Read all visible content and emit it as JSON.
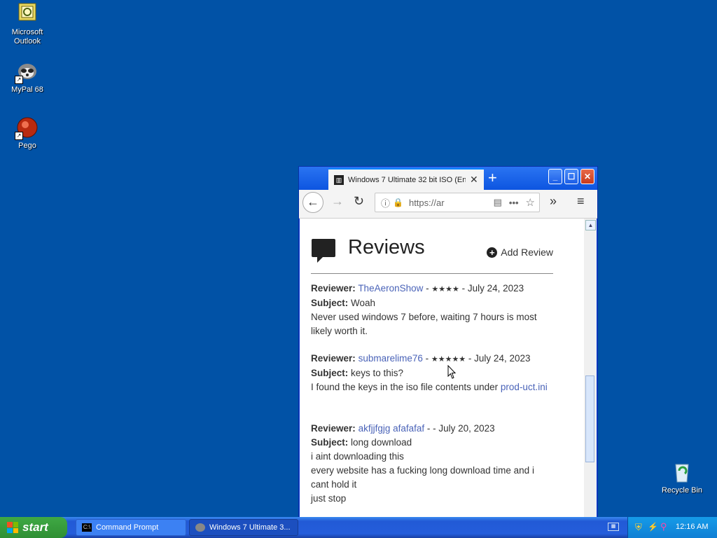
{
  "desktop": {
    "icons": [
      {
        "label": "Microsoft Outlook"
      },
      {
        "label": "MyPal 68"
      },
      {
        "label": "Pego"
      },
      {
        "label": "Recycle Bin"
      }
    ]
  },
  "browser": {
    "tab_title": "Windows 7 Ultimate 32 bit ISO (En",
    "url": "https://ar",
    "reviews_heading": "Reviews",
    "add_review": "Add Review",
    "reviews": [
      {
        "reviewer_label": "Reviewer:",
        "reviewer": "TheAeronShow",
        "stars": "★★★★",
        "date": "July 24, 2023",
        "subject_label": "Subject:",
        "subject": "Woah",
        "body": [
          "Never used windows 7 before, waiting 7 hours is most likely worth it."
        ]
      },
      {
        "reviewer_label": "Reviewer:",
        "reviewer": "submarelime76",
        "stars": "★★★★★",
        "date": "July 24, 2023",
        "subject_label": "Subject:",
        "subject": "keys to this?",
        "body_prefix": "I found the keys in the iso file contents under ",
        "body_link": "prod-uct.ini"
      },
      {
        "reviewer_label": "Reviewer:",
        "reviewer": "akfjjfgjg afafafaf",
        "stars": "",
        "date": "July 20, 2023",
        "subject_label": "Subject:",
        "subject": "long download",
        "body": [
          "i aint downloading this",
          "every website has a fucking long download time and i cant hold it",
          "just stop"
        ]
      }
    ]
  },
  "taskbar": {
    "start_label": "start",
    "tasks": [
      {
        "label": "Command Prompt"
      },
      {
        "label": "Windows 7 Ultimate 3..."
      }
    ],
    "clock": "12:16 AM"
  }
}
